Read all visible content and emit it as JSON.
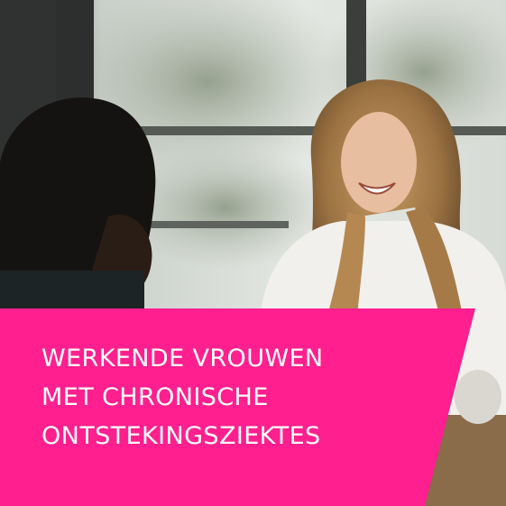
{
  "headline": {
    "line1": "WERKENDE VROUWEN",
    "line2": "MET CHRONISCHE",
    "line3": "ONTSTEKINGSZIEKTES"
  },
  "colors": {
    "banner": "#ff1f8e",
    "text": "#ffffff"
  },
  "photo": {
    "description_icon": "photo-two-women-laughing"
  }
}
